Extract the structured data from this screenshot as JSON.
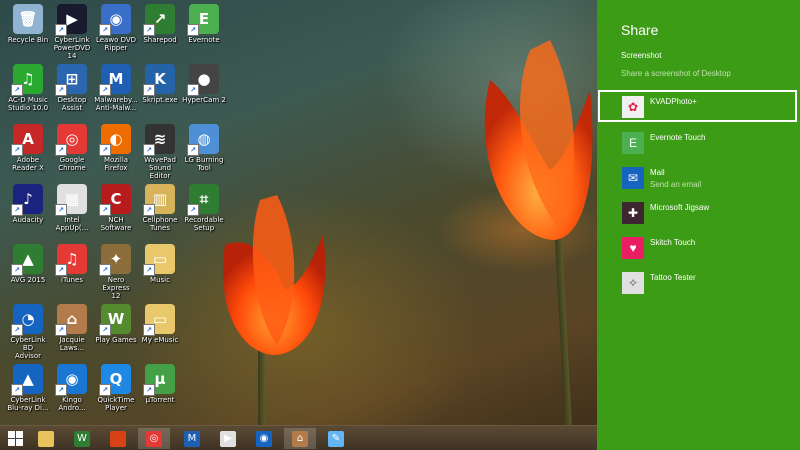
{
  "desktop_icons": [
    {
      "label": "Recycle Bin",
      "icon": "recycle-bin-icon",
      "color": "#8fb3d0",
      "glyph": "🗑"
    },
    {
      "label": "CyberLink\nPowerDVD 14",
      "icon": "powerdvd-icon",
      "color": "#1a1a2e",
      "glyph": "▶"
    },
    {
      "label": "Leawo DVD\nRipper",
      "icon": "leawo-icon",
      "color": "#3a6fc9",
      "glyph": "◉"
    },
    {
      "label": "Sharepod",
      "icon": "sharepod-icon",
      "color": "#2e7d32",
      "glyph": "↗"
    },
    {
      "label": "Evernote",
      "icon": "evernote-icon",
      "color": "#4caf50",
      "glyph": "E"
    },
    {
      "label": "AC-D Music\nStudio 10.0",
      "icon": "music-studio-icon",
      "color": "#2aa830",
      "glyph": "♫"
    },
    {
      "label": "Desktop\nAssist",
      "icon": "desktop-assist-icon",
      "color": "#2b66b0",
      "glyph": "⊞"
    },
    {
      "label": "Malwareby...\nAnti-Malw...",
      "icon": "malwarebytes-icon",
      "color": "#1e5fb3",
      "glyph": "M"
    },
    {
      "label": "Skript.exe",
      "icon": "skript-icon",
      "color": "#2563a8",
      "glyph": "K"
    },
    {
      "label": "HyperCam 2",
      "icon": "hypercam-icon",
      "color": "#444",
      "glyph": "●"
    },
    {
      "label": "Adobe\nReader X",
      "icon": "adobe-reader-icon",
      "color": "#c62828",
      "glyph": "A"
    },
    {
      "label": "Google\nChrome",
      "icon": "chrome-icon",
      "color": "#e53935",
      "glyph": "◎"
    },
    {
      "label": "Mozilla\nFirefox",
      "icon": "firefox-icon",
      "color": "#ef6c00",
      "glyph": "◐"
    },
    {
      "label": "WavePad\nSound Editor",
      "icon": "wavepad-icon",
      "color": "#333",
      "glyph": "≋"
    },
    {
      "label": "LG Burning\nTool",
      "icon": "lg-burning-icon",
      "color": "#4f8fd6",
      "glyph": "◍"
    },
    {
      "label": "Audacity",
      "icon": "audacity-icon",
      "color": "#1a237e",
      "glyph": "♪"
    },
    {
      "label": "Intel\nAppUp(...",
      "icon": "intel-appup-icon",
      "color": "#e0e0e0",
      "glyph": "▦"
    },
    {
      "label": "NCH\nSoftware",
      "icon": "nch-icon",
      "color": "#b71c1c",
      "glyph": "C"
    },
    {
      "label": "Cellphone\nTunes",
      "icon": "cellphone-tunes-icon",
      "color": "#d7b35a",
      "glyph": "▥"
    },
    {
      "label": "Recordable\nSetup",
      "icon": "recordable-setup-icon",
      "color": "#2e7d32",
      "glyph": "⌗"
    },
    {
      "label": "AVG 2015",
      "icon": "avg-icon",
      "color": "#2e7d32",
      "glyph": "▲"
    },
    {
      "label": "iTunes",
      "icon": "itunes-icon",
      "color": "#e53935",
      "glyph": "♫"
    },
    {
      "label": "Nero Express\n12",
      "icon": "nero-icon",
      "color": "#8a6d3b",
      "glyph": "✦"
    },
    {
      "label": "Music",
      "icon": "music-folder-icon",
      "color": "#e8c86a",
      "glyph": "▭"
    },
    {
      "label": "",
      "icon": "blank-icon",
      "color": "transparent",
      "glyph": ""
    },
    {
      "label": "CyberLink BD\nAdvisor",
      "icon": "bd-advisor-icon",
      "color": "#1565c0",
      "glyph": "◔"
    },
    {
      "label": "Jacquie\nLaws...",
      "icon": "jacquie-icon",
      "color": "#b37a4a",
      "glyph": "⌂"
    },
    {
      "label": "Play Games",
      "icon": "play-games-icon",
      "color": "#558b2f",
      "glyph": "W"
    },
    {
      "label": "My eMusic",
      "icon": "emusic-folder-icon",
      "color": "#e8c86a",
      "glyph": "▭"
    },
    {
      "label": "",
      "icon": "blank-icon",
      "color": "transparent",
      "glyph": ""
    },
    {
      "label": "CyberLink\nBlu-ray Di...",
      "icon": "bluray-icon",
      "color": "#1565c0",
      "glyph": "▲"
    },
    {
      "label": "Kingo\nAndro...",
      "icon": "kingo-icon",
      "color": "#1976d2",
      "glyph": "◉"
    },
    {
      "label": "QuickTime\nPlayer",
      "icon": "quicktime-icon",
      "color": "#1e88e5",
      "glyph": "Q"
    },
    {
      "label": "µTorrent",
      "icon": "utorrent-icon",
      "color": "#43a047",
      "glyph": "µ"
    }
  ],
  "taskbar": [
    {
      "name": "start-button",
      "icon": "windows-logo-icon",
      "color": "#ffffff",
      "glyph": "⊞"
    },
    {
      "name": "taskbar-explorer",
      "icon": "file-explorer-icon",
      "color": "#e8c25a",
      "glyph": ""
    },
    {
      "name": "taskbar-play-games",
      "icon": "play-games-icon",
      "color": "#2e7d32",
      "glyph": "W"
    },
    {
      "name": "taskbar-store",
      "icon": "store-icon",
      "color": "#d84315",
      "glyph": ""
    },
    {
      "name": "taskbar-chrome",
      "icon": "chrome-icon",
      "color": "#e53935",
      "glyph": "◎"
    },
    {
      "name": "taskbar-malwarebytes",
      "icon": "malwarebytes-icon",
      "color": "#1e5fb3",
      "glyph": "M"
    },
    {
      "name": "taskbar-video",
      "icon": "video-player-icon",
      "color": "#e0e0e0",
      "glyph": "▶"
    },
    {
      "name": "taskbar-media",
      "icon": "media-center-icon",
      "color": "#1565c0",
      "glyph": "◉"
    },
    {
      "name": "taskbar-jacquie",
      "icon": "jacquie-icon",
      "color": "#b37a4a",
      "glyph": "⌂"
    },
    {
      "name": "taskbar-paint",
      "icon": "paint-icon",
      "color": "#64b5f6",
      "glyph": "✎"
    }
  ],
  "share": {
    "title": "Share",
    "subtitle": "Screenshot",
    "description": "Share a screenshot of Desktop",
    "apps": [
      {
        "name": "KVADPhoto+",
        "sub": "",
        "icon": "kvadphoto-icon",
        "color": "#f0f0f0",
        "glyph": "✿",
        "glyph_color": "#d24"
      },
      {
        "name": "Evernote Touch",
        "sub": "",
        "icon": "evernote-icon",
        "color": "#4caf50",
        "glyph": "E",
        "glyph_color": "#ffffff"
      },
      {
        "name": "Mail",
        "sub": "Send an email",
        "icon": "mail-icon",
        "color": "#1565c0",
        "glyph": "✉",
        "glyph_color": "#ffffff"
      },
      {
        "name": "Microsoft Jigsaw",
        "sub": "",
        "icon": "jigsaw-icon",
        "color": "#3e2630",
        "glyph": "✚",
        "glyph_color": "#ffffff"
      },
      {
        "name": "Skitch Touch",
        "sub": "",
        "icon": "skitch-icon",
        "color": "#e91e63",
        "glyph": "♥",
        "glyph_color": "#ffffff"
      },
      {
        "name": "Tattoo Tester",
        "sub": "",
        "icon": "tattoo-tester-icon",
        "color": "#e0e0e0",
        "glyph": "✧",
        "glyph_color": "#555555"
      }
    ],
    "selected_index": 0,
    "background": "#3c9c16"
  }
}
